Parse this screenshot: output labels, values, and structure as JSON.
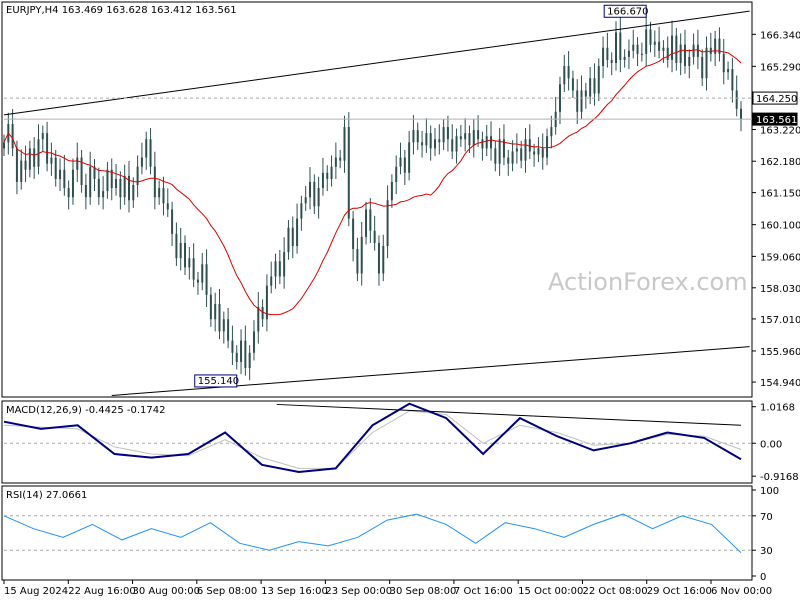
{
  "colors": {
    "background": "#ffffff",
    "candles": "#2f4f4f",
    "ma": "#e00000",
    "macd": "#000080",
    "signal": "#c0c0c0",
    "rsi": "#1e90ff",
    "grid_dashed": "#a9a9a9",
    "watermark": "#c8c8c8"
  },
  "chart_data": [
    {
      "type": "candlestick",
      "title": "EURJPY,H4 163.469 163.628 163.412 163.561",
      "watermark": "ActionForex.com",
      "ylim": [
        154.45,
        167.4
      ],
      "yticks": [
        "166.340",
        "165.290",
        "164.250",
        "163.561",
        "163.220",
        "162.180",
        "161.150",
        "160.100",
        "159.060",
        "158.030",
        "157.010",
        "155.960",
        "154.940"
      ],
      "horizontal_line": 164.25,
      "last_price": 163.561,
      "x_labels": [
        "15 Aug 2024",
        "22 Aug 16:00",
        "30 Aug 00:00",
        "6 Sep 08:00",
        "13 Sep 16:00",
        "23 Sep 00:00",
        "30 Sep 08:00",
        "7 Oct 16:00",
        "15 Oct 00:00",
        "22 Oct 08:00",
        "29 Oct 16:00",
        "6 Nov 00:00"
      ],
      "annotations": [
        {
          "text": "166.670",
          "bar": 149,
          "value": 166.67
        },
        {
          "text": "155.140",
          "bar": 54,
          "value": 155.14
        }
      ],
      "trendlines": [
        {
          "from": [
            0,
            163.7
          ],
          "to": [
            173,
            167.1
          ]
        },
        {
          "from": [
            25,
            154.5
          ],
          "to": [
            173,
            156.1
          ]
        }
      ],
      "close": [
        162.8,
        163.4,
        162.6,
        161.5,
        162.2,
        161.9,
        162.6,
        162.0,
        162.9,
        163.1,
        162.1,
        162.3,
        161.6,
        161.9,
        161.3,
        161.0,
        161.9,
        162.3,
        161.4,
        161.0,
        162.0,
        161.6,
        161.0,
        161.2,
        161.9,
        161.3,
        161.6,
        161.0,
        161.7,
        160.9,
        161.4,
        162.0,
        162.3,
        162.9,
        162.0,
        161.0,
        161.3,
        160.8,
        160.6,
        159.8,
        159.0,
        159.5,
        158.7,
        159.0,
        158.3,
        158.2,
        158.8,
        157.8,
        157.0,
        157.5,
        156.6,
        157.0,
        156.3,
        155.9,
        155.6,
        156.3,
        155.4,
        155.9,
        156.6,
        157.4,
        157.0,
        158.1,
        158.4,
        158.9,
        158.4,
        159.2,
        160.0,
        159.4,
        160.3,
        160.8,
        161.0,
        161.5,
        160.7,
        161.3,
        161.8,
        161.6,
        162.0,
        162.3,
        162.2,
        163.3,
        160.3,
        159.3,
        158.5,
        159.7,
        160.6,
        159.9,
        159.5,
        158.5,
        159.4,
        160.9,
        161.5,
        162.0,
        162.3,
        161.8,
        162.8,
        163.2,
        162.8,
        162.7,
        163.1,
        162.6,
        162.9,
        162.8,
        163.3,
        162.9,
        162.5,
        163.0,
        162.9,
        163.1,
        162.7,
        163.2,
        162.9,
        162.6,
        163.0,
        162.6,
        162.1,
        162.9,
        162.3,
        162.1,
        162.5,
        162.6,
        162.2,
        162.9,
        162.5,
        162.4,
        162.6,
        162.3,
        163.0,
        163.3,
        163.8,
        164.7,
        165.3,
        164.9,
        164.5,
        163.8,
        164.5,
        164.3,
        164.9,
        164.4,
        165.3,
        165.9,
        165.5,
        165.4,
        166.4,
        165.5,
        165.6,
        165.8,
        166.0,
        165.7,
        165.7,
        166.5,
        166.0,
        166.1,
        165.8,
        165.9,
        165.5,
        166.3,
        165.4,
        166.0,
        165.3,
        165.6,
        166.0,
        165.6,
        164.9,
        165.9,
        165.7,
        166.2,
        165.7,
        165.1,
        165.2,
        164.5,
        163.9,
        163.561
      ],
      "ma_period": 20
    },
    {
      "type": "line",
      "title": "MACD(12,26,9) -0.4425 -0.1742",
      "yticks": [
        "1.0168",
        "0.00",
        "-0.9168"
      ],
      "ylim": [
        -1.05,
        1.12
      ],
      "series": [
        {
          "name": "MACD",
          "x_frac": [
            0,
            0.05,
            0.1,
            0.15,
            0.2,
            0.25,
            0.3,
            0.35,
            0.4,
            0.45,
            0.5,
            0.55,
            0.6,
            0.65,
            0.7,
            0.75,
            0.8,
            0.85,
            0.9,
            0.95,
            1.0
          ],
          "values": [
            0.6,
            0.4,
            0.5,
            -0.3,
            -0.4,
            -0.3,
            0.3,
            -0.6,
            -0.8,
            -0.7,
            0.5,
            1.1,
            0.7,
            -0.3,
            0.7,
            0.2,
            -0.2,
            0.0,
            0.3,
            0.15,
            -0.4425
          ]
        },
        {
          "name": "Signal",
          "x_frac": [
            0,
            0.05,
            0.1,
            0.15,
            0.2,
            0.25,
            0.3,
            0.35,
            0.4,
            0.45,
            0.5,
            0.55,
            0.6,
            0.65,
            0.7,
            0.75,
            0.8,
            0.85,
            0.9,
            0.95,
            1.0
          ],
          "values": [
            0.5,
            0.45,
            0.4,
            -0.1,
            -0.3,
            -0.35,
            0.1,
            -0.4,
            -0.7,
            -0.7,
            0.3,
            0.9,
            0.8,
            0.0,
            0.5,
            0.3,
            -0.05,
            0.0,
            0.25,
            0.2,
            -0.1742
          ]
        }
      ],
      "trendline": {
        "from": [
          0.37,
          1.08
        ],
        "to": [
          1.0,
          0.5
        ]
      }
    },
    {
      "type": "line",
      "title": "RSI(14) 27.0661",
      "yticks": [
        "100",
        "70",
        "30",
        "0"
      ],
      "ylim": [
        0,
        100
      ],
      "series": [
        {
          "name": "RSI",
          "x_frac": [
            0,
            0.04,
            0.08,
            0.12,
            0.16,
            0.2,
            0.24,
            0.28,
            0.32,
            0.36,
            0.4,
            0.44,
            0.48,
            0.52,
            0.56,
            0.6,
            0.64,
            0.68,
            0.72,
            0.76,
            0.8,
            0.84,
            0.88,
            0.92,
            0.96,
            1.0
          ],
          "values": [
            70,
            55,
            45,
            60,
            42,
            55,
            45,
            62,
            38,
            30,
            40,
            35,
            45,
            65,
            72,
            60,
            38,
            62,
            55,
            45,
            60,
            72,
            55,
            70,
            60,
            27.0661
          ]
        }
      ]
    }
  ]
}
